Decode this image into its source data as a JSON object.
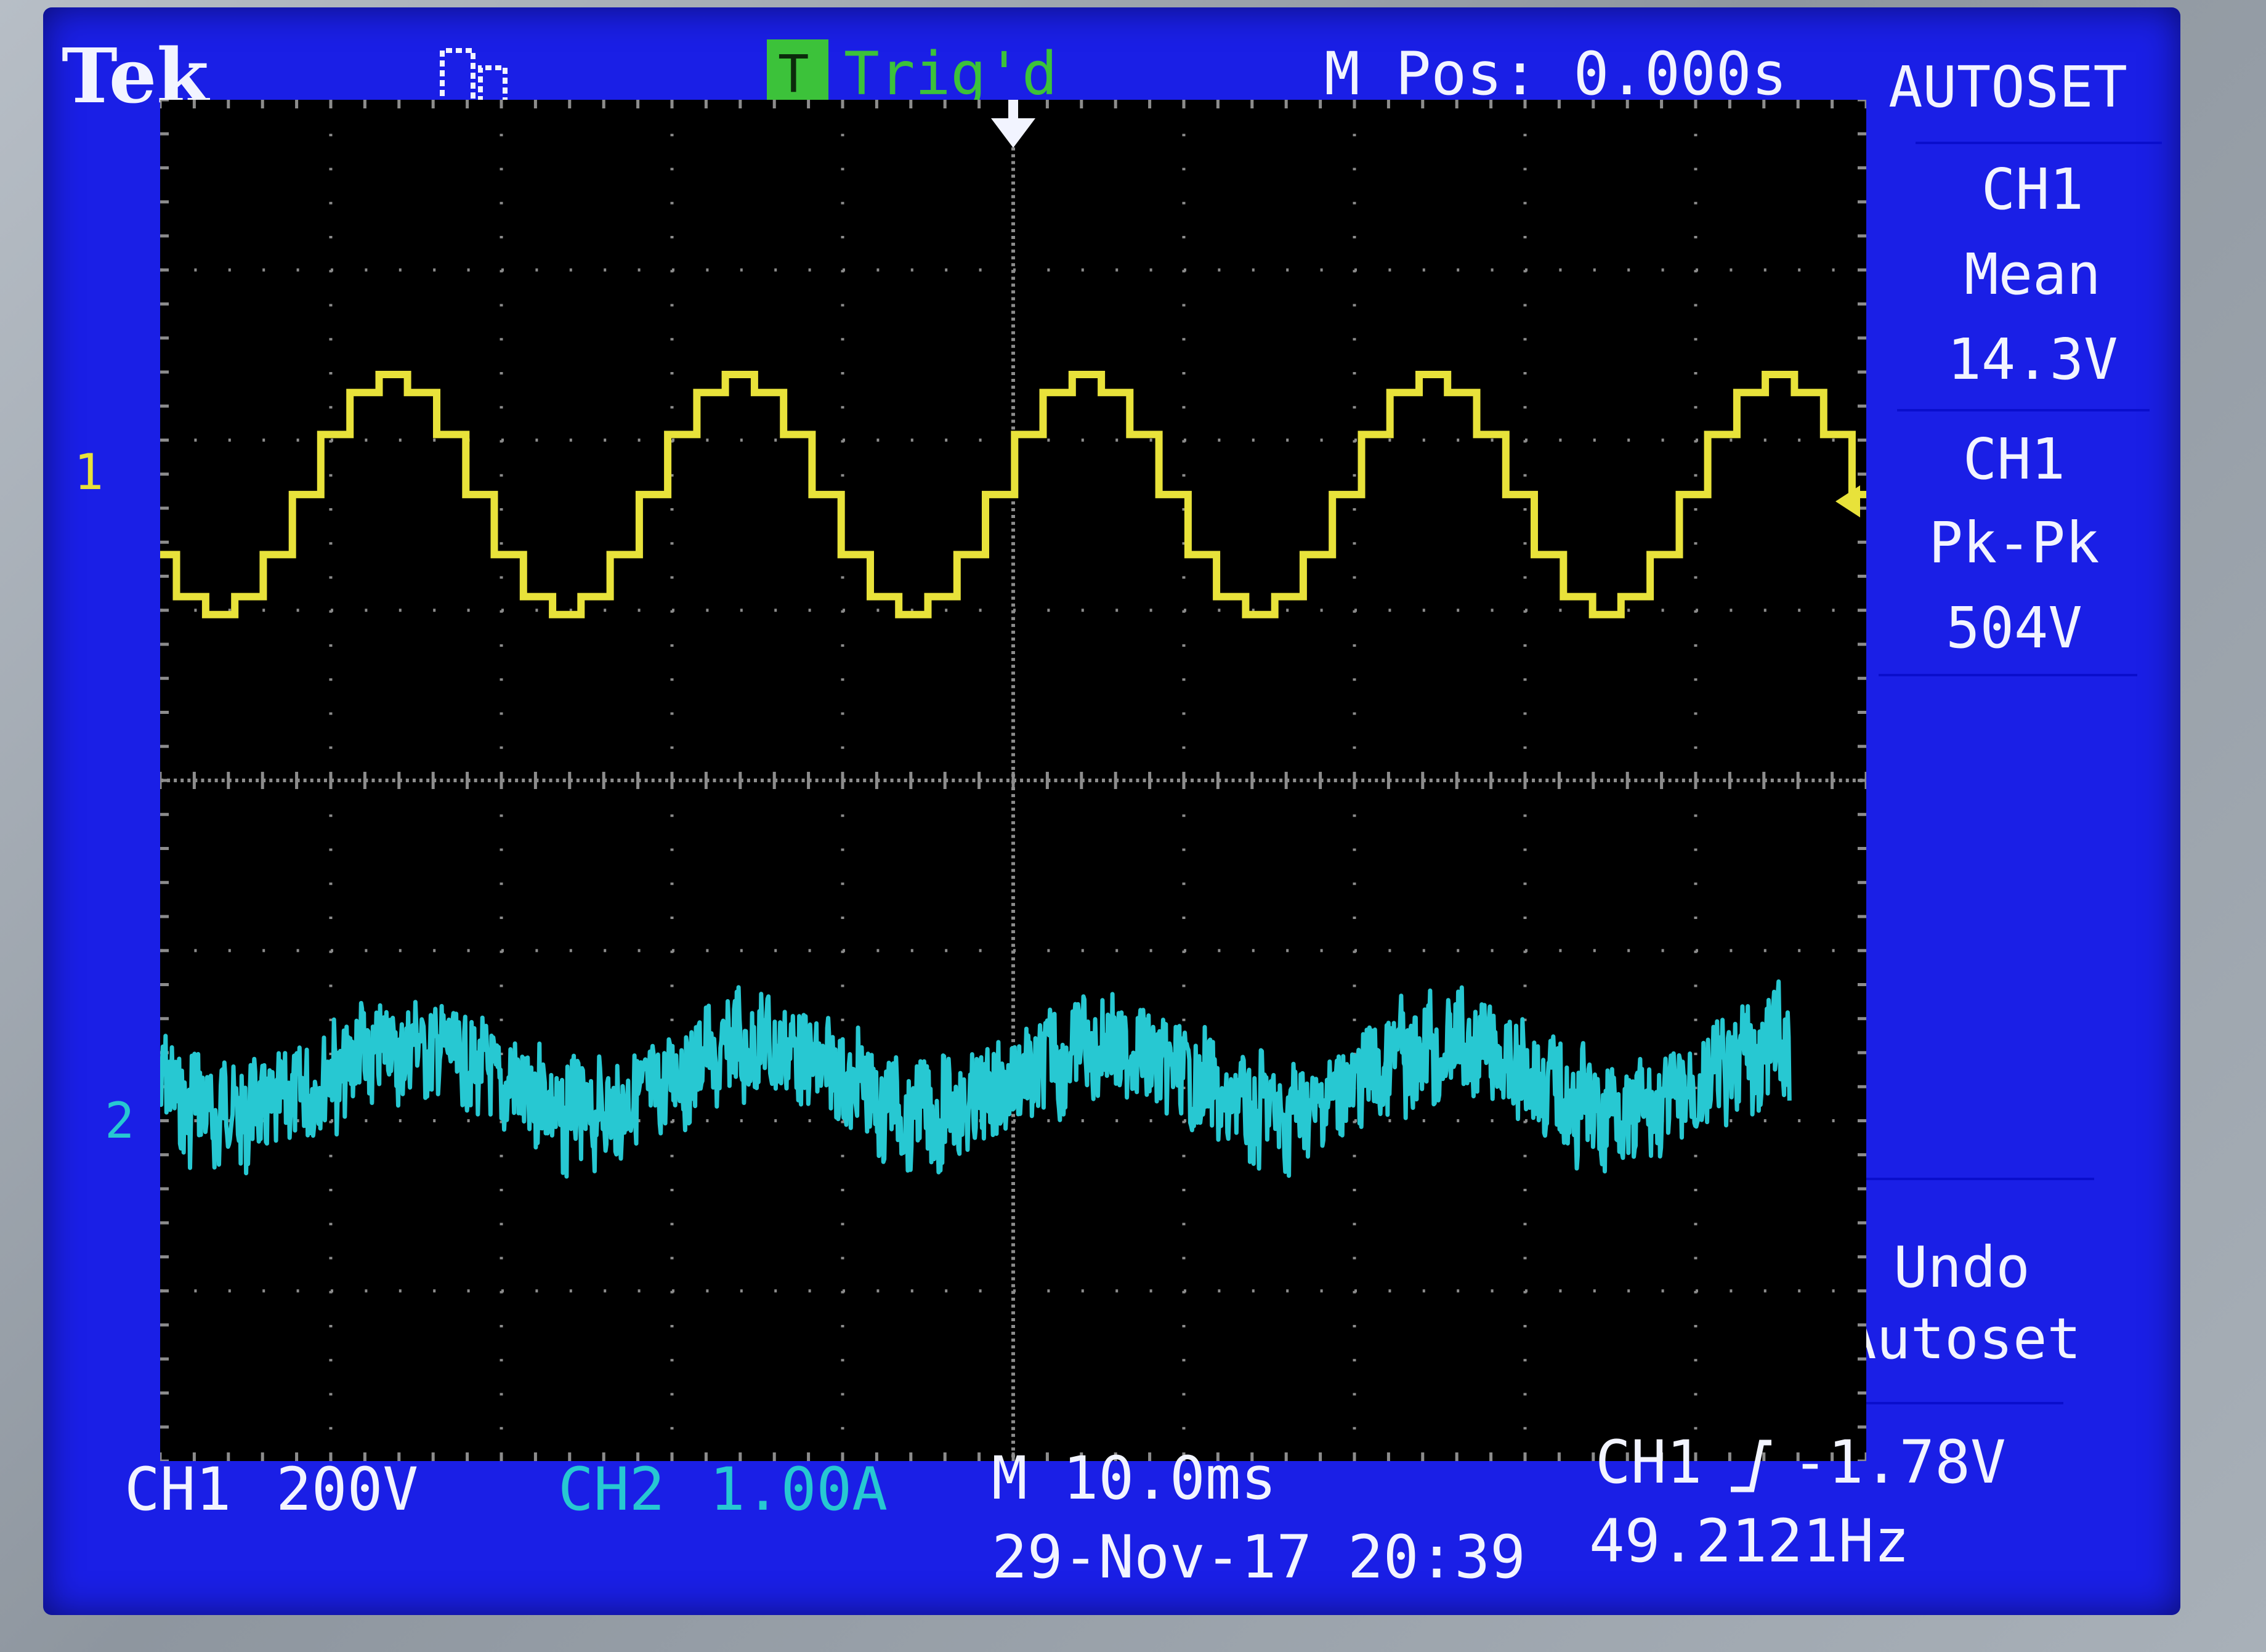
{
  "header": {
    "brand": "Tek",
    "trigger_icon": "trigger-t-icon",
    "trigger_letter": "T",
    "trigger_status": "Trig'd",
    "position": "M Pos: 0.000s"
  },
  "menu": {
    "title": "AUTOSET",
    "items": [
      {
        "lines": [
          "CH1",
          "Mean",
          "14.3V"
        ]
      },
      {
        "lines": [
          "CH1",
          "Pk-Pk",
          "504V"
        ]
      }
    ],
    "undo": [
      "Undo",
      "Autoset"
    ]
  },
  "markers": {
    "ch1_ref": "1",
    "ch2_ref": "2"
  },
  "footer": {
    "ch1_label": "CH1",
    "ch1_scale": "200V",
    "ch2_label": "CH2",
    "ch2_scale": "1.00A",
    "timebase": "M 10.0ms",
    "trigger_source": "CH1",
    "trigger_slope_icon": "rising-edge-icon",
    "trigger_level": "-1.78V",
    "datetime": "29-Nov-17 20:39",
    "frequency": "49.2121Hz"
  },
  "colors": {
    "screen_bg": "#1a1fe6",
    "graticule_bg": "#000000",
    "ch1": "#e8e23a",
    "ch2": "#27c8d2",
    "text": "#f2f4ff",
    "trigger_box": "#3cc23a"
  },
  "chart_data": {
    "type": "line",
    "grid": true,
    "divisions": {
      "x": 10,
      "y": 8
    },
    "series": [
      {
        "name": "CH1",
        "unit": "V",
        "volts_per_div": 200,
        "mean": 14.3,
        "pk_pk": 504,
        "shape": "5-level stepped sine",
        "frequency_hz": 49.2121
      },
      {
        "name": "CH2",
        "unit": "A",
        "amps_per_div": 1.0,
        "shape": "noisy stepped sine",
        "frequency_hz": 49.2121
      }
    ]
  }
}
